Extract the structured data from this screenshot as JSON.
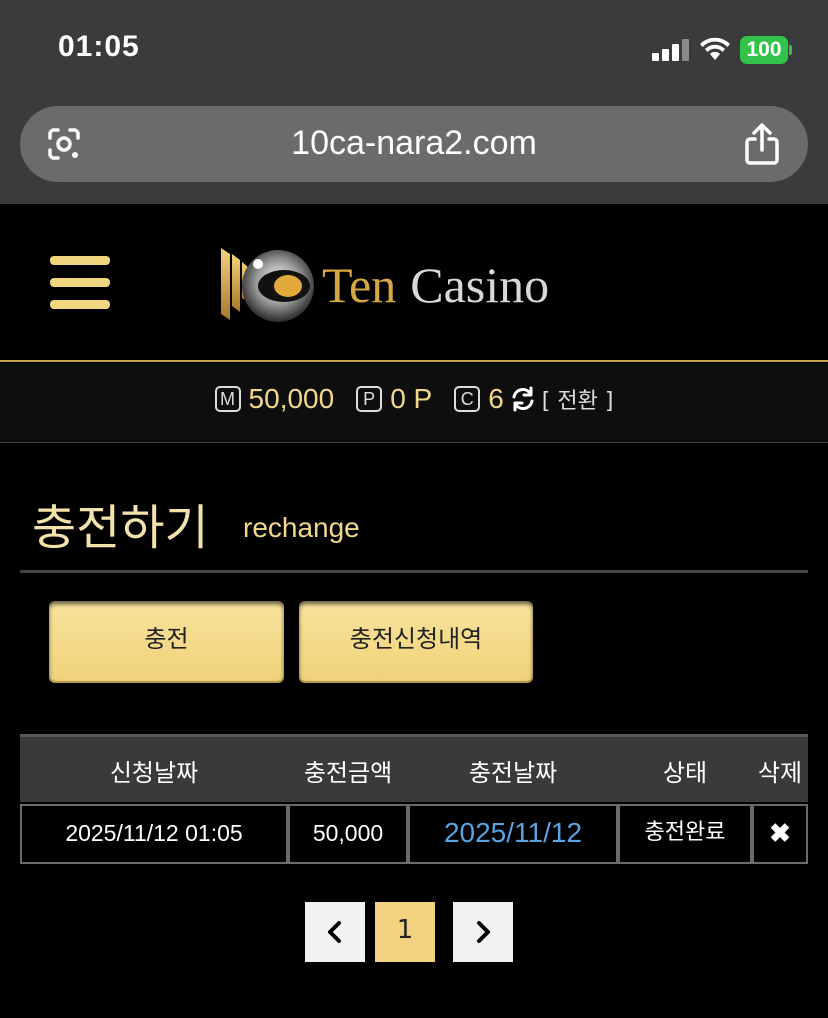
{
  "status_bar": {
    "time": "01:05",
    "battery": "100"
  },
  "browser": {
    "url": "10ca-nara2.com"
  },
  "header": {
    "logo_ten": "Ten",
    "logo_casino": "Casino"
  },
  "balance": {
    "money_label": "M",
    "money_value": "50,000",
    "point_label": "P",
    "point_value": "0 P",
    "coin_label": "C",
    "coin_value": "6",
    "convert_label": "[ 전환 ]"
  },
  "page": {
    "title": "충전하기",
    "subtitle": "rechange"
  },
  "buttons": {
    "charge": "충전",
    "history": "충전신청내역"
  },
  "table": {
    "headers": [
      "신청날짜",
      "충전금액",
      "충전날짜",
      "상태",
      "삭제"
    ],
    "rows": [
      {
        "request_date": "2025/11/12 01:05",
        "amount": "50,000",
        "charge_date": "2025/11/12",
        "status": "충전완료",
        "delete": "✖"
      }
    ]
  },
  "pagination": {
    "current": "1"
  },
  "colors": {
    "accent_gold": "#f2d27e",
    "link_blue": "#5aa2e0",
    "battery_green": "#33c34a"
  }
}
